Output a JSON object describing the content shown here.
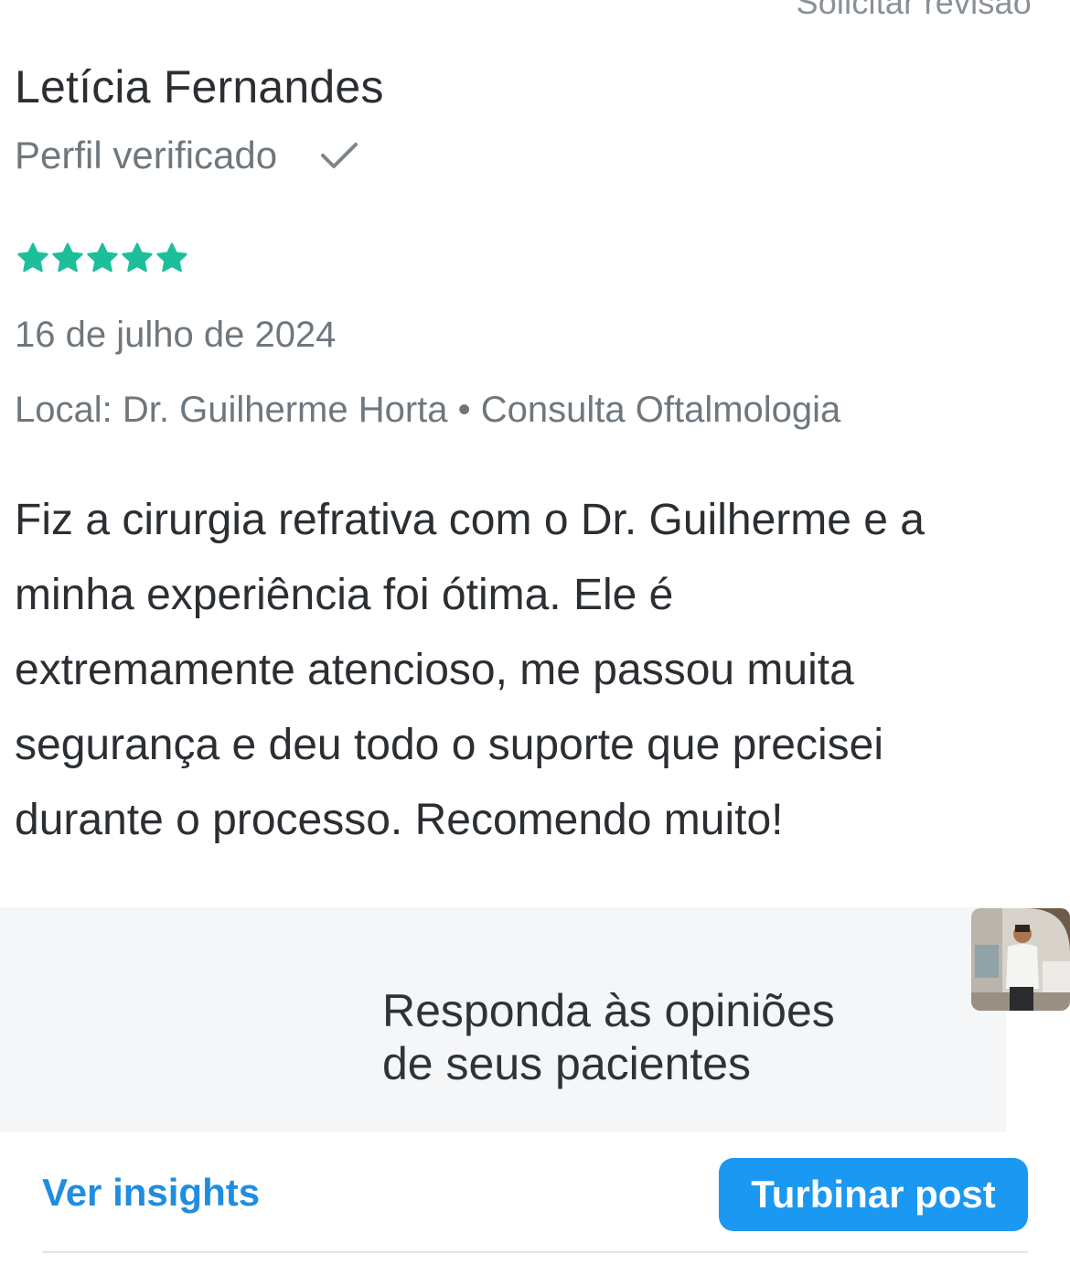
{
  "header": {
    "request_review_label": "Solicitar revisão"
  },
  "review": {
    "reviewer_name": "Letícia Fernandes",
    "verified_label": "Perfil verificado",
    "rating": 5,
    "rating_max": 5,
    "star_color": "#1dbf9b",
    "date": "16 de julho de 2024",
    "location": "Local: Dr. Guilherme Horta • Consulta Oftalmologia",
    "body_lines": [
      "Fiz a cirurgia refrativa com o Dr. Guilherme e a",
      "minha experiência foi ótima. Ele é",
      "extremamente atencioso, me passou muita",
      "segurança e deu todo o suporte que precisei",
      "durante o processo. Recomendo muito!"
    ]
  },
  "promo": {
    "line1": "Responda às opiniões",
    "line2": "de seus pacientes"
  },
  "actions": {
    "insights_label": "Ver insights",
    "boost_label": "Turbinar post",
    "accent_color": "#1a98f2"
  }
}
